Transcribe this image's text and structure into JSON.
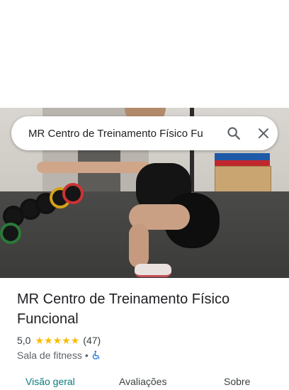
{
  "search": {
    "query": "MR Centro de Treinamento Físico Fu"
  },
  "place": {
    "name": "MR Centro de Treinamento Físico Funcional",
    "rating": "5,0",
    "stars": [
      "★",
      "★",
      "★",
      "★",
      "★"
    ],
    "review_count": "(47)",
    "category": "Sala de fitness",
    "separator": "•"
  },
  "tabs": [
    {
      "label": "Visão geral",
      "active": true
    },
    {
      "label": "Avaliações",
      "active": false
    },
    {
      "label": "Sobre",
      "active": false
    }
  ],
  "colors": {
    "star": "#fbbc04",
    "active_tab": "#0b7c7c",
    "accessibility_icon": "#1a73e8"
  },
  "icons": {
    "search": "search-icon",
    "close": "close-icon",
    "accessibility": "wheelchair-accessible-icon"
  }
}
